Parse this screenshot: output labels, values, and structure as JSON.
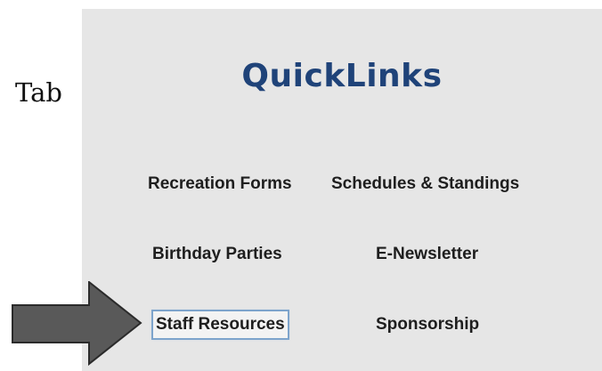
{
  "side_label": "Tab",
  "panel": {
    "title": "QuickLinks",
    "links": {
      "recreation_forms": "Recreation Forms",
      "schedules_standings": "Schedules & Standings",
      "birthday_parties": "Birthday Parties",
      "e_newsletter": "E-Newsletter",
      "staff_resources": "Staff Resources",
      "sponsorship": "Sponsorship"
    }
  },
  "colors": {
    "title": "#1f4379",
    "panel_background": "#e6e6e6",
    "focus_outline": "#7da4cc",
    "arrow_fill": "#595959"
  },
  "annotation": {
    "arrow_icon": "right-arrow-icon",
    "points_to": "staff_resources"
  }
}
